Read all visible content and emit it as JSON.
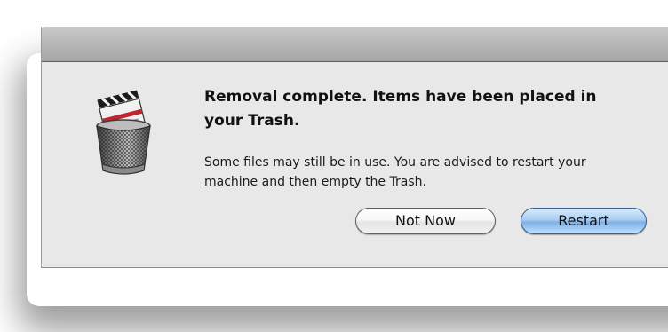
{
  "dialog": {
    "icon": "trash-can-with-clapperboard-icon",
    "title": "Removal complete. Items have been placed in your Trash.",
    "message": "Some files may still be in use. You are advised to restart your machine and then empty the Trash.",
    "buttons": {
      "secondary_label": "Not Now",
      "primary_label": "Restart"
    },
    "colors": {
      "primary_button": "#7fb0e6",
      "window_background": "#e8e8e8",
      "titlebar": "#b8b8b8"
    }
  }
}
